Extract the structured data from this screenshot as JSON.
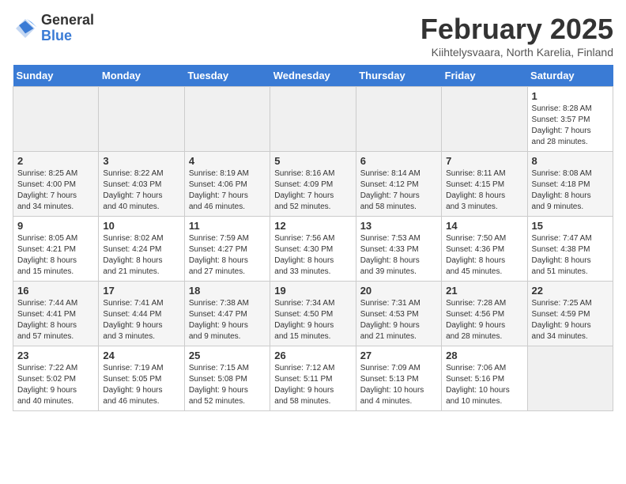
{
  "header": {
    "logo_general": "General",
    "logo_blue": "Blue",
    "title": "February 2025",
    "subtitle": "Kiihtelysvaara, North Karelia, Finland"
  },
  "weekdays": [
    "Sunday",
    "Monday",
    "Tuesday",
    "Wednesday",
    "Thursday",
    "Friday",
    "Saturday"
  ],
  "weeks": [
    [
      {
        "day": "",
        "info": ""
      },
      {
        "day": "",
        "info": ""
      },
      {
        "day": "",
        "info": ""
      },
      {
        "day": "",
        "info": ""
      },
      {
        "day": "",
        "info": ""
      },
      {
        "day": "",
        "info": ""
      },
      {
        "day": "1",
        "info": "Sunrise: 8:28 AM\nSunset: 3:57 PM\nDaylight: 7 hours\nand 28 minutes."
      }
    ],
    [
      {
        "day": "2",
        "info": "Sunrise: 8:25 AM\nSunset: 4:00 PM\nDaylight: 7 hours\nand 34 minutes."
      },
      {
        "day": "3",
        "info": "Sunrise: 8:22 AM\nSunset: 4:03 PM\nDaylight: 7 hours\nand 40 minutes."
      },
      {
        "day": "4",
        "info": "Sunrise: 8:19 AM\nSunset: 4:06 PM\nDaylight: 7 hours\nand 46 minutes."
      },
      {
        "day": "5",
        "info": "Sunrise: 8:16 AM\nSunset: 4:09 PM\nDaylight: 7 hours\nand 52 minutes."
      },
      {
        "day": "6",
        "info": "Sunrise: 8:14 AM\nSunset: 4:12 PM\nDaylight: 7 hours\nand 58 minutes."
      },
      {
        "day": "7",
        "info": "Sunrise: 8:11 AM\nSunset: 4:15 PM\nDaylight: 8 hours\nand 3 minutes."
      },
      {
        "day": "8",
        "info": "Sunrise: 8:08 AM\nSunset: 4:18 PM\nDaylight: 8 hours\nand 9 minutes."
      }
    ],
    [
      {
        "day": "9",
        "info": "Sunrise: 8:05 AM\nSunset: 4:21 PM\nDaylight: 8 hours\nand 15 minutes."
      },
      {
        "day": "10",
        "info": "Sunrise: 8:02 AM\nSunset: 4:24 PM\nDaylight: 8 hours\nand 21 minutes."
      },
      {
        "day": "11",
        "info": "Sunrise: 7:59 AM\nSunset: 4:27 PM\nDaylight: 8 hours\nand 27 minutes."
      },
      {
        "day": "12",
        "info": "Sunrise: 7:56 AM\nSunset: 4:30 PM\nDaylight: 8 hours\nand 33 minutes."
      },
      {
        "day": "13",
        "info": "Sunrise: 7:53 AM\nSunset: 4:33 PM\nDaylight: 8 hours\nand 39 minutes."
      },
      {
        "day": "14",
        "info": "Sunrise: 7:50 AM\nSunset: 4:36 PM\nDaylight: 8 hours\nand 45 minutes."
      },
      {
        "day": "15",
        "info": "Sunrise: 7:47 AM\nSunset: 4:38 PM\nDaylight: 8 hours\nand 51 minutes."
      }
    ],
    [
      {
        "day": "16",
        "info": "Sunrise: 7:44 AM\nSunset: 4:41 PM\nDaylight: 8 hours\nand 57 minutes."
      },
      {
        "day": "17",
        "info": "Sunrise: 7:41 AM\nSunset: 4:44 PM\nDaylight: 9 hours\nand 3 minutes."
      },
      {
        "day": "18",
        "info": "Sunrise: 7:38 AM\nSunset: 4:47 PM\nDaylight: 9 hours\nand 9 minutes."
      },
      {
        "day": "19",
        "info": "Sunrise: 7:34 AM\nSunset: 4:50 PM\nDaylight: 9 hours\nand 15 minutes."
      },
      {
        "day": "20",
        "info": "Sunrise: 7:31 AM\nSunset: 4:53 PM\nDaylight: 9 hours\nand 21 minutes."
      },
      {
        "day": "21",
        "info": "Sunrise: 7:28 AM\nSunset: 4:56 PM\nDaylight: 9 hours\nand 28 minutes."
      },
      {
        "day": "22",
        "info": "Sunrise: 7:25 AM\nSunset: 4:59 PM\nDaylight: 9 hours\nand 34 minutes."
      }
    ],
    [
      {
        "day": "23",
        "info": "Sunrise: 7:22 AM\nSunset: 5:02 PM\nDaylight: 9 hours\nand 40 minutes."
      },
      {
        "day": "24",
        "info": "Sunrise: 7:19 AM\nSunset: 5:05 PM\nDaylight: 9 hours\nand 46 minutes."
      },
      {
        "day": "25",
        "info": "Sunrise: 7:15 AM\nSunset: 5:08 PM\nDaylight: 9 hours\nand 52 minutes."
      },
      {
        "day": "26",
        "info": "Sunrise: 7:12 AM\nSunset: 5:11 PM\nDaylight: 9 hours\nand 58 minutes."
      },
      {
        "day": "27",
        "info": "Sunrise: 7:09 AM\nSunset: 5:13 PM\nDaylight: 10 hours\nand 4 minutes."
      },
      {
        "day": "28",
        "info": "Sunrise: 7:06 AM\nSunset: 5:16 PM\nDaylight: 10 hours\nand 10 minutes."
      },
      {
        "day": "",
        "info": ""
      }
    ]
  ]
}
